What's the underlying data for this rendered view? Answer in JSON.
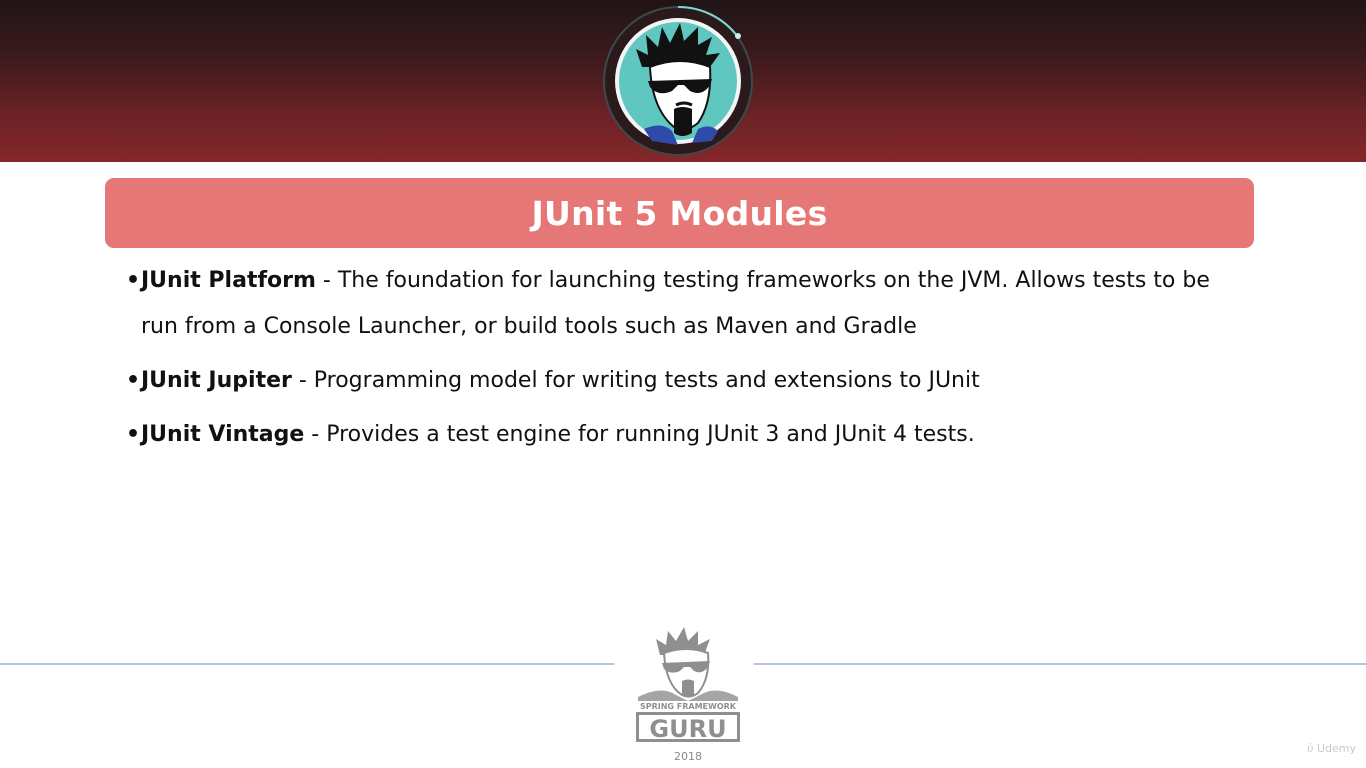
{
  "slide": {
    "title": "JUnit 5 Modules",
    "bullets": [
      {
        "term": "JUnit Platform",
        "description": " - The foundation for launching testing frameworks on the JVM. Allows tests to be run from a Console Launcher, or build tools such as Maven and Gradle"
      },
      {
        "term": "JUnit Jupiter",
        "description": " - Programming model for writing tests and extensions to JUnit"
      },
      {
        "term": "JUnit Vintage",
        "description": " - Provides a test engine for running JUnit 3 and JUnit 4 tests."
      }
    ]
  },
  "footer": {
    "logo_top_text": "SPRING FRAMEWORK",
    "logo_main_text": "GURU",
    "year": "2018"
  },
  "watermark": "Udemy",
  "colors": {
    "header_dark": "#201416",
    "header_red": "#85272a",
    "title_bar": "#e57876",
    "avatar_ring": "#5fc7c0",
    "footer_line": "#b7c4e0"
  }
}
